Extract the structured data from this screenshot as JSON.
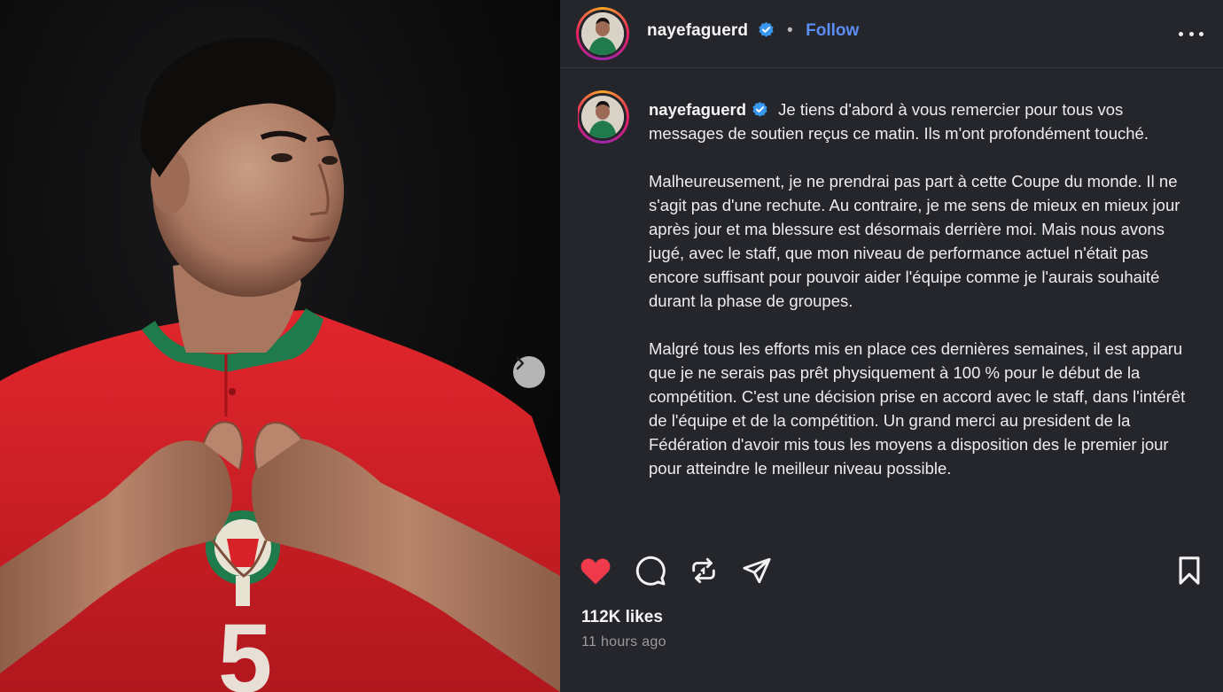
{
  "author": {
    "username": "nayefaguerd",
    "verified": true,
    "follow_label": "Follow"
  },
  "caption": {
    "paragraphs": [
      "Je tiens d'abord à vous remercier pour tous vos messages de soutien reçus ce matin. Ils m'ont profondément touché.",
      "Malheureusement, je ne prendrai pas part à cette Coupe du monde. Il ne s'agit pas d'une rechute. Au contraire, je me sens de mieux en mieux jour après jour et ma blessure est désormais derrière moi. Mais nous avons jugé, avec le staff, que mon niveau de performance actuel n'était pas encore suffisant pour pouvoir aider l'équipe comme je l'aurais souhaité durant la phase de groupes.",
      "Malgré tous les efforts mis en place ces dernières semaines, il est apparu que je ne serais pas prêt physiquement à 100 % pour le début de la compétition. C'est une décision prise en accord avec le staff, dans l'intérêt de l'équipe et de la compétition. Un grand merci au president de la Fédération d'avoir mis tous les moyens a disposition des le premier jour pour atteindre le meilleur niveau possible."
    ]
  },
  "stats": {
    "likes": "112K likes",
    "posted": "11 hours ago",
    "liked": true
  },
  "media": {
    "jersey_number": "5"
  },
  "icons": {
    "like": "heart-icon",
    "comment": "comment-icon",
    "repost": "repost-icon",
    "share": "share-icon",
    "save": "bookmark-icon",
    "more": "more-icon",
    "next": "chevron-right-icon"
  },
  "colors": {
    "panel_bg": "#25262b",
    "follow": "#5b8df6",
    "heart": "#ee3a4a",
    "verified": "#3897f0",
    "jersey": "#d8222a"
  }
}
